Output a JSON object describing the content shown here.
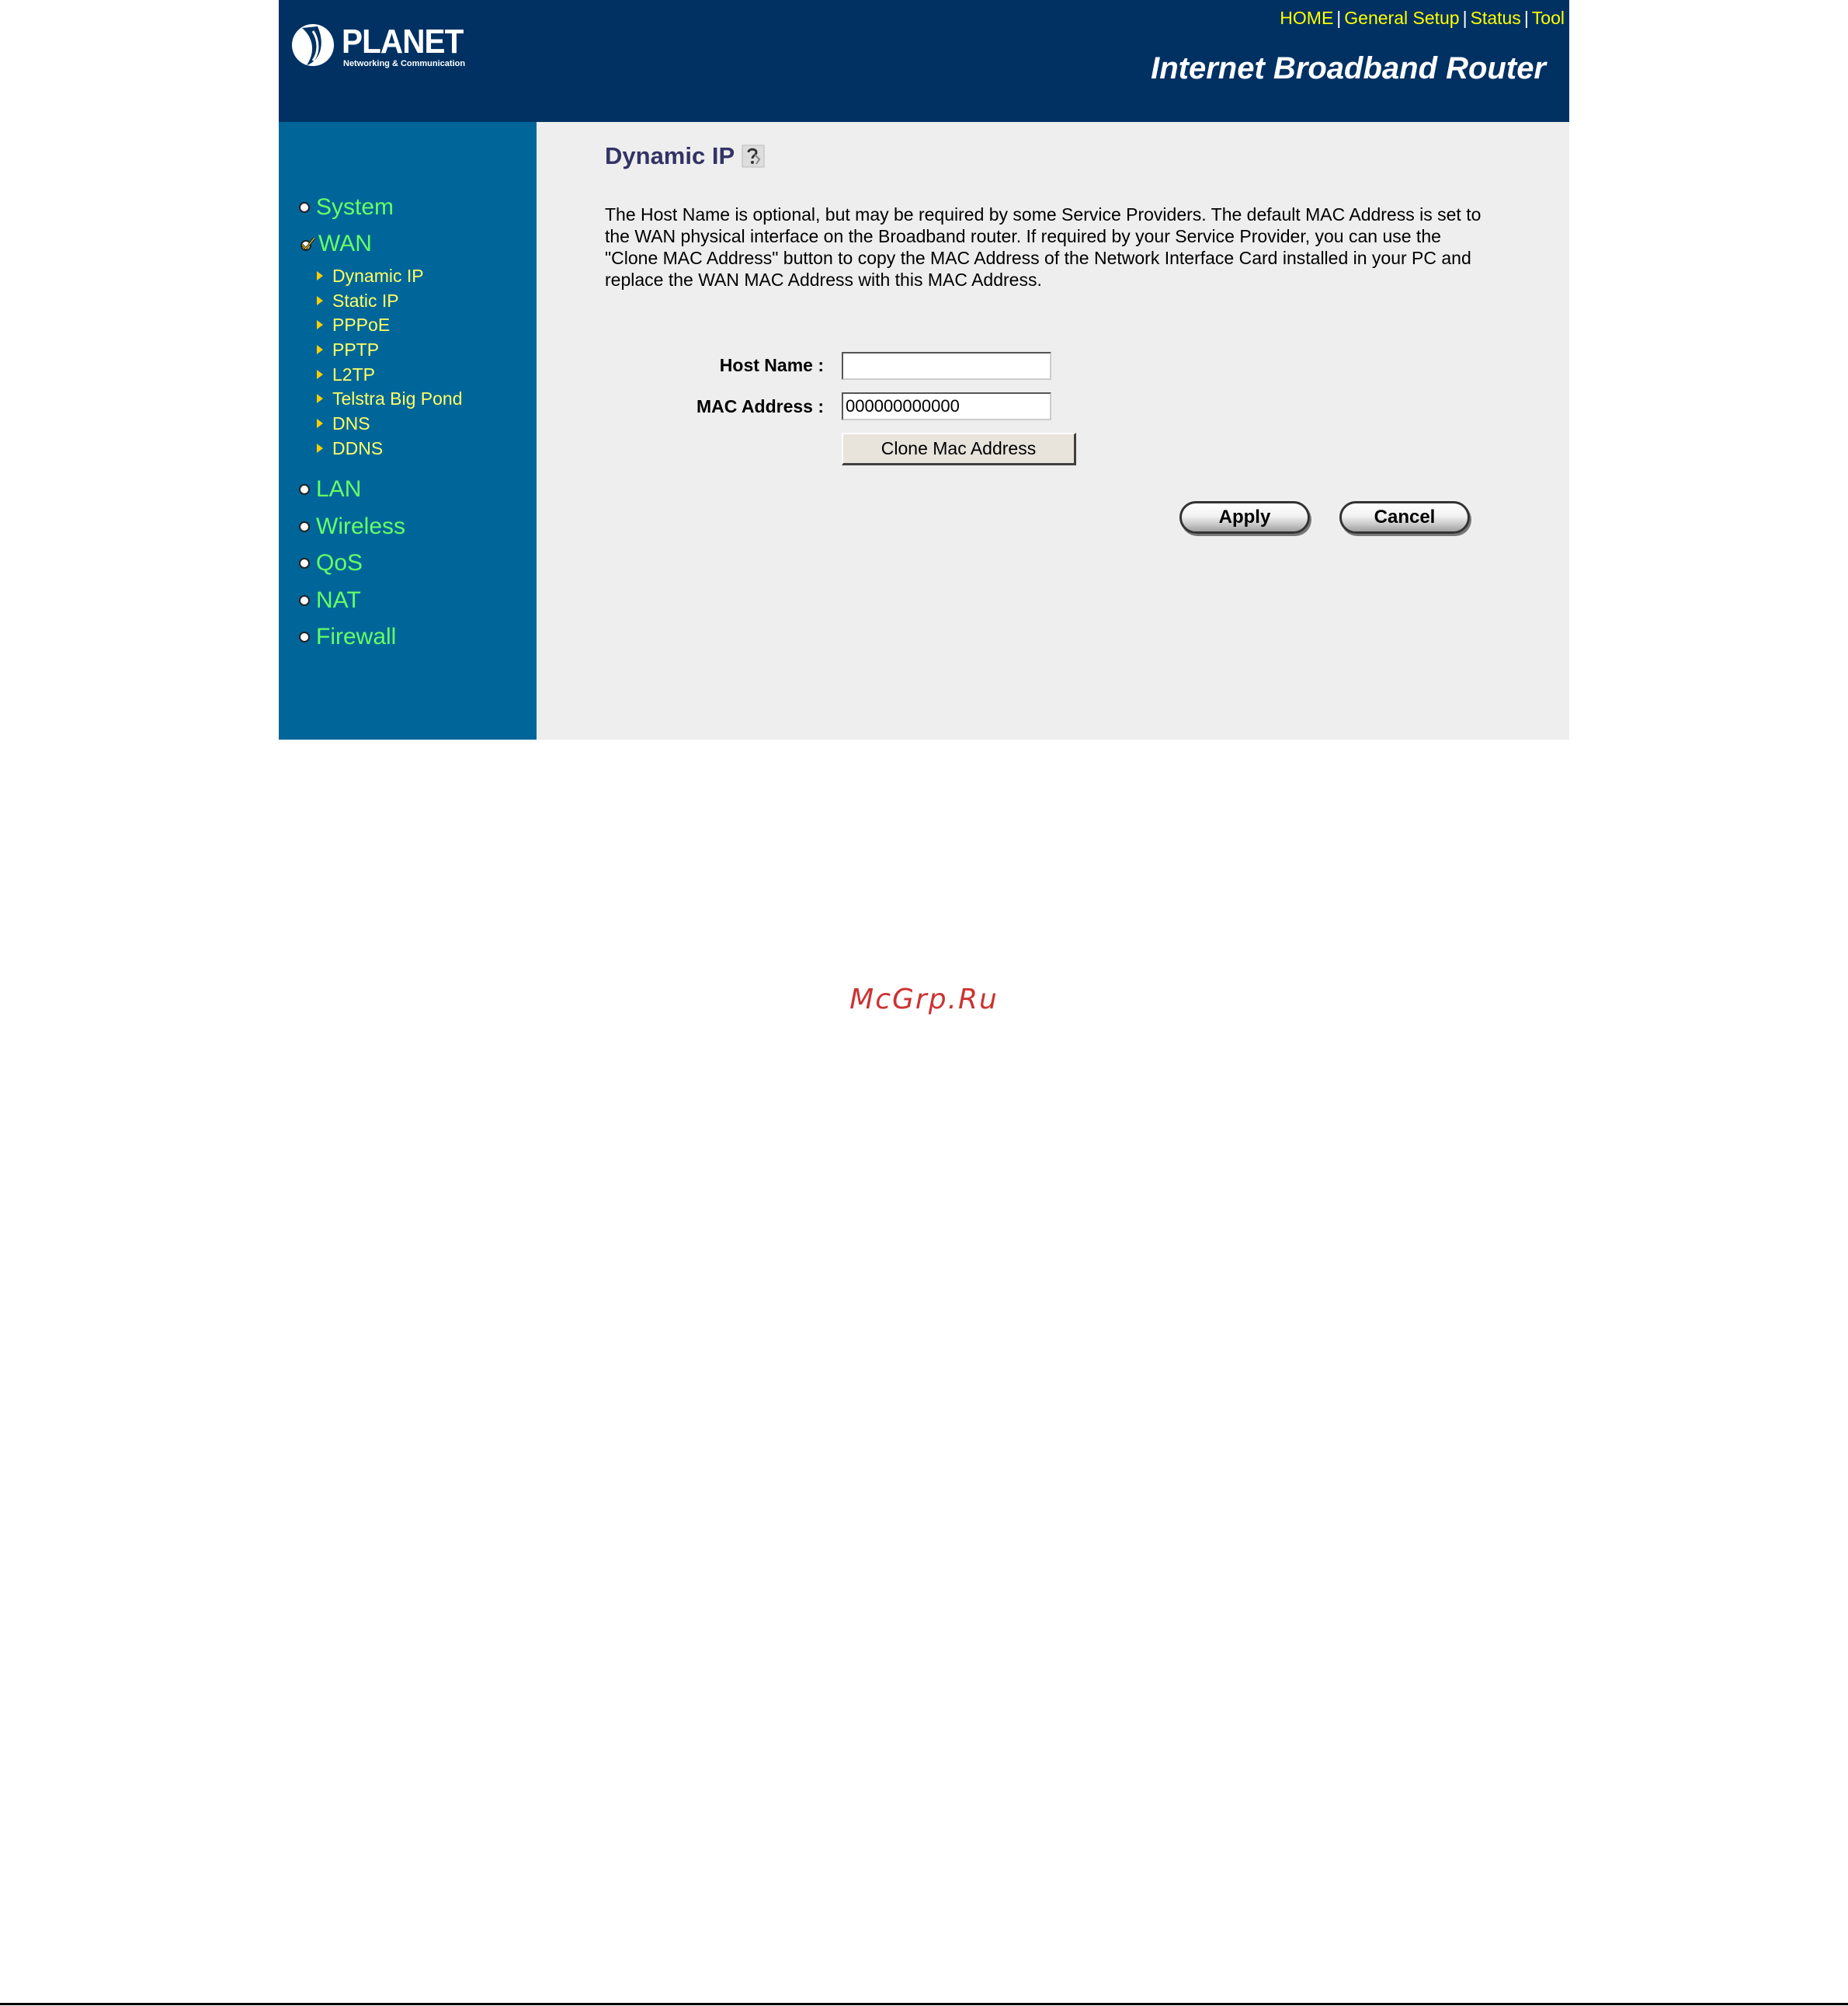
{
  "brand": {
    "name": "PLANET",
    "tagline": "Networking & Communication"
  },
  "top_nav": {
    "items": [
      "HOME",
      "General Setup",
      "Status",
      "Tool"
    ]
  },
  "product_title": "Internet Broadband Router",
  "sidebar": {
    "items": [
      {
        "label": "System",
        "state": "unchecked"
      },
      {
        "label": "WAN",
        "state": "checked"
      },
      {
        "label": "LAN",
        "state": "unchecked"
      },
      {
        "label": "Wireless",
        "state": "unchecked"
      },
      {
        "label": "QoS",
        "state": "unchecked"
      },
      {
        "label": "NAT",
        "state": "unchecked"
      },
      {
        "label": "Firewall",
        "state": "unchecked"
      }
    ],
    "wan_subitems": [
      "Dynamic IP",
      "Static IP",
      "PPPoE",
      "PPTP",
      "L2TP",
      "Telstra Big Pond",
      "DNS",
      "DDNS"
    ]
  },
  "main": {
    "title": "Dynamic IP",
    "description": "The Host Name is optional, but may be required by some Service Providers. The default MAC Address is set to the WAN physical interface on the Broadband router. If required by your Service Provider, you can use the \"Clone MAC Address\" button to copy the MAC Address of the Network Interface Card installed in your PC and replace the WAN MAC Address with this MAC Address.",
    "host_name_label": "Host Name :",
    "host_name_value": "",
    "mac_address_label": "MAC Address :",
    "mac_address_value": "000000000000",
    "clone_button": "Clone Mac Address",
    "apply_button": "Apply",
    "cancel_button": "Cancel"
  },
  "watermark": "McGrp.Ru",
  "colors": {
    "header_bg": "#003163",
    "sidebar_bg": "#006699",
    "content_bg": "#eeeeee",
    "menu_main": "#66ff66",
    "menu_sub": "#ffff66",
    "nav_link": "#ffff00",
    "title": "#333366"
  }
}
